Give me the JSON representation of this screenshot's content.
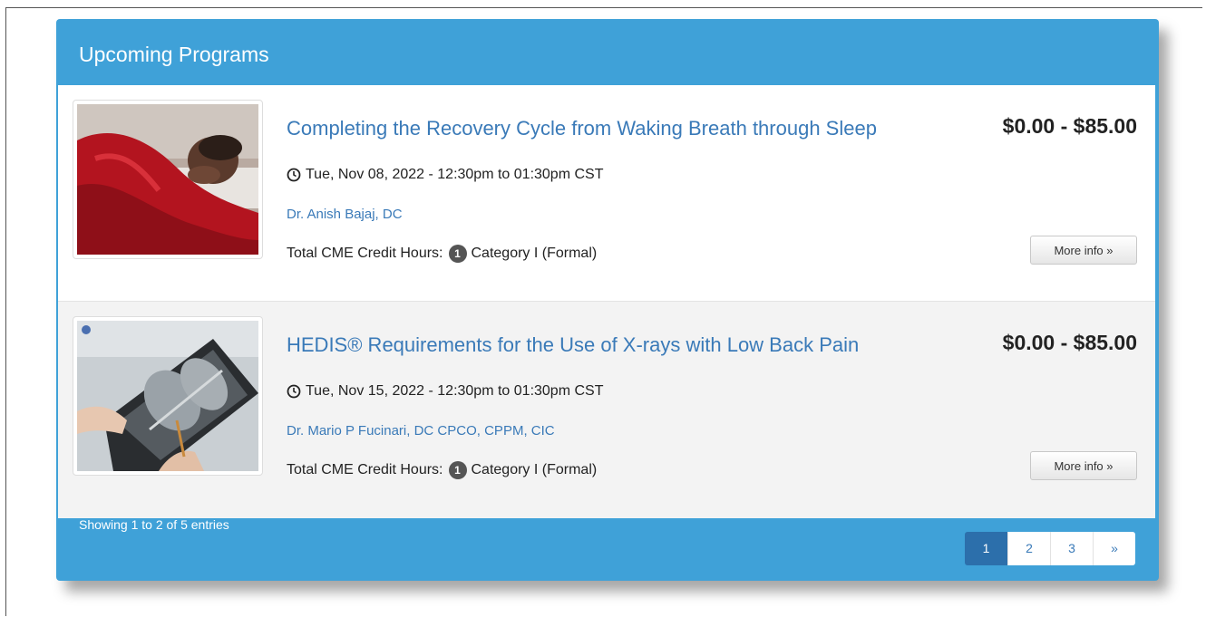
{
  "panel": {
    "title": "Upcoming Programs",
    "footer_text": "Showing 1 to 2 of 5 entries"
  },
  "programs": [
    {
      "title": "Completing the Recovery Cycle from Waking Breath through Sleep",
      "price": "$0.00 - $85.00",
      "date": "Tue, Nov 08, 2022 - 12:30pm to 01:30pm CST",
      "speaker": "Dr. Anish Bajaj, DC",
      "credits_label": "Total CME Credit Hours:",
      "credits_count": "1",
      "credits_category": "Category I (Formal)",
      "more_label": "More info »",
      "thumb_icon": "sleeping-child-photo"
    },
    {
      "title": "HEDIS® Requirements for the Use of X-rays with Low Back Pain",
      "price": "$0.00 - $85.00",
      "date": "Tue, Nov 15, 2022 - 12:30pm to 01:30pm CST",
      "speaker": "Dr. Mario P Fucinari, DC CPCO, CPPM, CIC",
      "credits_label": "Total CME Credit Hours:",
      "credits_count": "1",
      "credits_category": "Category I (Formal)",
      "more_label": "More info »",
      "thumb_icon": "chest-xray-photo"
    }
  ],
  "pagination": {
    "pages": [
      "1",
      "2",
      "3"
    ],
    "next": "»",
    "active": "1"
  },
  "colors": {
    "panel_blue": "#3fa1d8",
    "link_blue": "#3a7ab8",
    "active_page": "#2c6fab"
  }
}
